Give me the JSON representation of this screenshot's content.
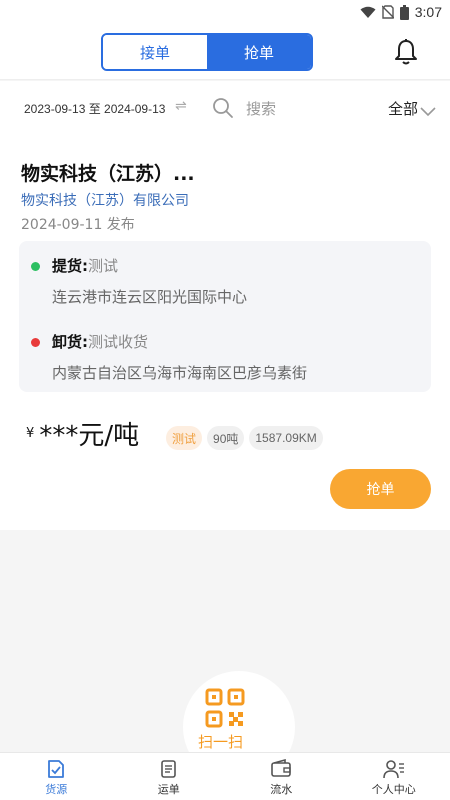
{
  "status_bar": {
    "time": "3:07",
    "icons": [
      "wifi-icon",
      "no-sim-icon",
      "battery-icon"
    ]
  },
  "header": {
    "tabs": [
      {
        "label": "接单",
        "active": false
      },
      {
        "label": "抢单",
        "active": true
      }
    ],
    "bell_icon": "bell-icon"
  },
  "filter": {
    "date_range": "2023-09-13 至 2024-09-13",
    "swap_icon": "⇌",
    "search_placeholder": "搜索",
    "category": "全部"
  },
  "order": {
    "title": "物实科技（江苏）...",
    "company": "物实科技（江苏）有限公司",
    "published": "2024-09-11 发布",
    "pickup": {
      "label": "提货:",
      "name": "测试",
      "address": "连云港市连云区阳光国际中心"
    },
    "unload": {
      "label": "卸货:",
      "name": "测试收货",
      "address": "内蒙古自治区乌海市海南区巴彦乌素街"
    },
    "price_symbol": "¥",
    "price": "***元/吨",
    "tags": [
      "测试",
      "90吨",
      "1587.09KM"
    ],
    "grab_button": "抢单"
  },
  "scan": {
    "label": "扫一扫"
  },
  "tab_bar": [
    {
      "label": "货源",
      "icon": "cargo-icon",
      "active": true
    },
    {
      "label": "运单",
      "icon": "waybill-icon",
      "active": false
    },
    {
      "label": "流水",
      "icon": "wallet-icon",
      "active": false
    },
    {
      "label": "个人中心",
      "icon": "profile-icon",
      "active": false
    }
  ],
  "colors": {
    "primary": "#2a6de0",
    "accent": "#f9a732",
    "link": "#3b6db8"
  }
}
